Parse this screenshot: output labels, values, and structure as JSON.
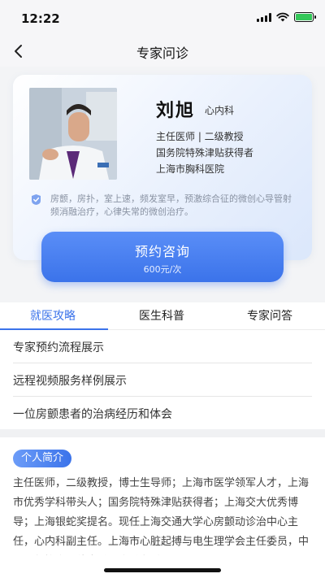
{
  "status_bar": {
    "time": "12:22"
  },
  "nav": {
    "title": "专家问诊"
  },
  "doctor": {
    "name": "刘旭",
    "department": "心内科",
    "title": "主任医师 | 二级教授",
    "honor": "国务院特殊津贴获得者",
    "hospital": "上海市胸科医院",
    "specialty": "房颤，房扑，室上速，频发室早，预激综合征的微创心导管射频消融治疗，心律失常的微创治疗。"
  },
  "booking": {
    "label": "预约咨询",
    "price": "600元/次"
  },
  "tabs": [
    {
      "label": "就医攻略",
      "active": true
    },
    {
      "label": "医生科普",
      "active": false
    },
    {
      "label": "专家问答",
      "active": false
    }
  ],
  "guide_items": [
    "专家预约流程展示",
    "远程视频服务样例展示",
    "一位房颤患者的治病经历和体会"
  ],
  "intro": {
    "badge": "个人简介",
    "text": "主任医师，二级教授，博士生导师；上海市医学领军人才，上海市优秀学科带头人；国务院特殊津贴获得者；上海交大优秀博导；上海银蛇奖提名。现任上海交通大学心房颤动诊治中心主任，心内科副主任。上海市心脏起搏与电生理学会主任委员，中国医师协会心律失常分会常务委员。"
  },
  "colors": {
    "accent": "#3b73ea",
    "battery": "#34c759"
  },
  "icons": {
    "back": "chevron-left-icon",
    "specialty": "badge-check-icon",
    "signal": "signal-icon",
    "wifi": "wifi-icon",
    "battery": "battery-charging-icon"
  }
}
